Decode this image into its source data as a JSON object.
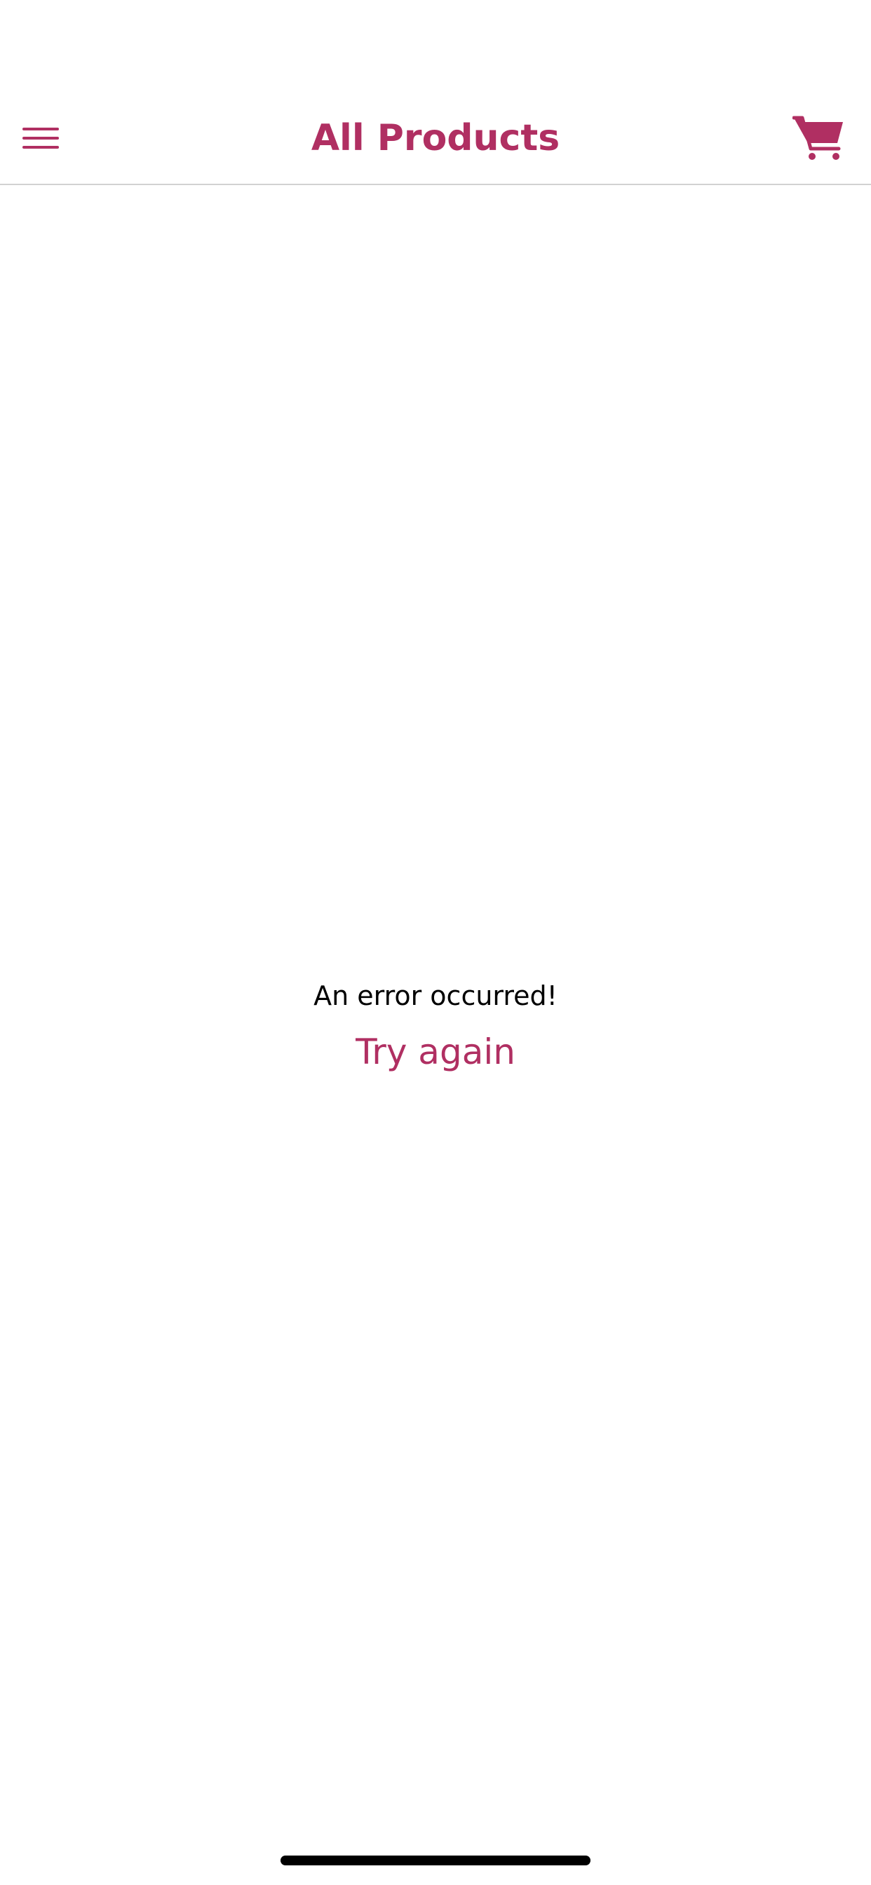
{
  "header": {
    "title": "All Products",
    "menu_icon": "hamburger-menu-icon",
    "cart_icon": "shopping-cart-icon"
  },
  "error": {
    "message": "An error occurred!",
    "retry_label": "Try again"
  },
  "colors": {
    "accent": "#b02f62",
    "text": "#000000",
    "divider": "#d2d2d2",
    "background": "#ffffff"
  }
}
